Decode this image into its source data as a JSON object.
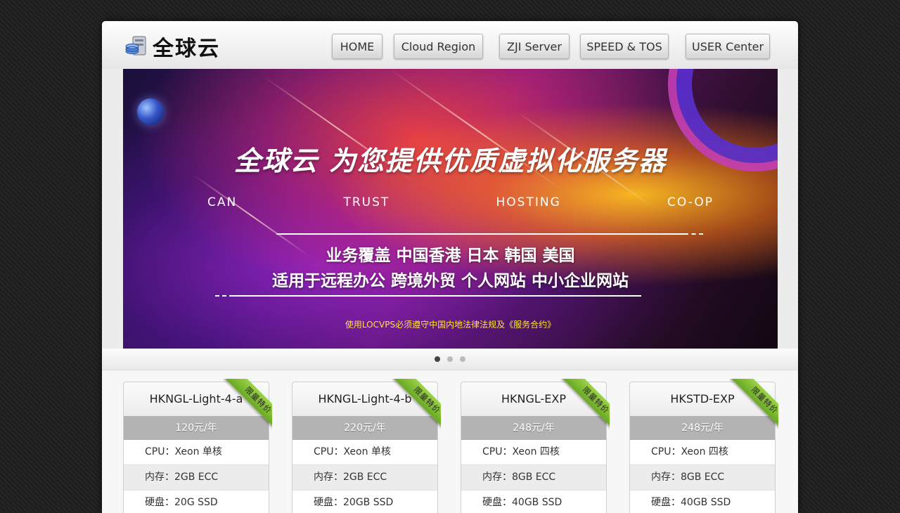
{
  "brand": {
    "name": "全球云",
    "logo_icon": "server-database-icon"
  },
  "nav": [
    {
      "label": "HOME"
    },
    {
      "label": "Cloud Region"
    },
    {
      "label": "ZJI Server"
    },
    {
      "label": "SPEED & TOS"
    },
    {
      "label": "USER Center"
    }
  ],
  "banner": {
    "headline": "全球云 为您提供优质虚拟化服务器",
    "tagline_words": [
      "CAN",
      "TRUST",
      "HOSTING",
      "CO-OP"
    ],
    "coverage": "业务覆盖 中国香港 日本 韩国 美国",
    "usage": "适用于远程办公 跨境外贸 个人网站 中小企业网站",
    "notice": "使用LOCVPS必须遵守中国内地法律法规及《服务合约》"
  },
  "slider": {
    "slides": 3,
    "active_index": 0
  },
  "plans": [
    {
      "name": "HKNGL-Light-4-a",
      "price": "120元/年",
      "badge": "限量特价",
      "cpu": "CPU：Xeon 单核",
      "ram": "内存：2GB ECC",
      "disk": "硬盘：20G SSD"
    },
    {
      "name": "HKNGL-Light-4-b",
      "price": "220元/年",
      "badge": "限量特价",
      "cpu": "CPU：Xeon 单核",
      "ram": "内存：2GB ECC",
      "disk": "硬盘：20GB SSD"
    },
    {
      "name": "HKNGL-EXP",
      "price": "248元/年",
      "badge": "限量特价",
      "cpu": "CPU：Xeon 四核",
      "ram": "内存：8GB ECC",
      "disk": "硬盘：40GB SSD"
    },
    {
      "name": "HKSTD-EXP",
      "price": "248元/年",
      "badge": "限量特价",
      "cpu": "CPU：Xeon 四核",
      "ram": "内存：8GB ECC",
      "disk": "硬盘：40GB SSD"
    }
  ],
  "colors": {
    "ribbon": "#7cbc2e",
    "price_bar": "#b3b3b3",
    "notice": "#ffe23a"
  }
}
